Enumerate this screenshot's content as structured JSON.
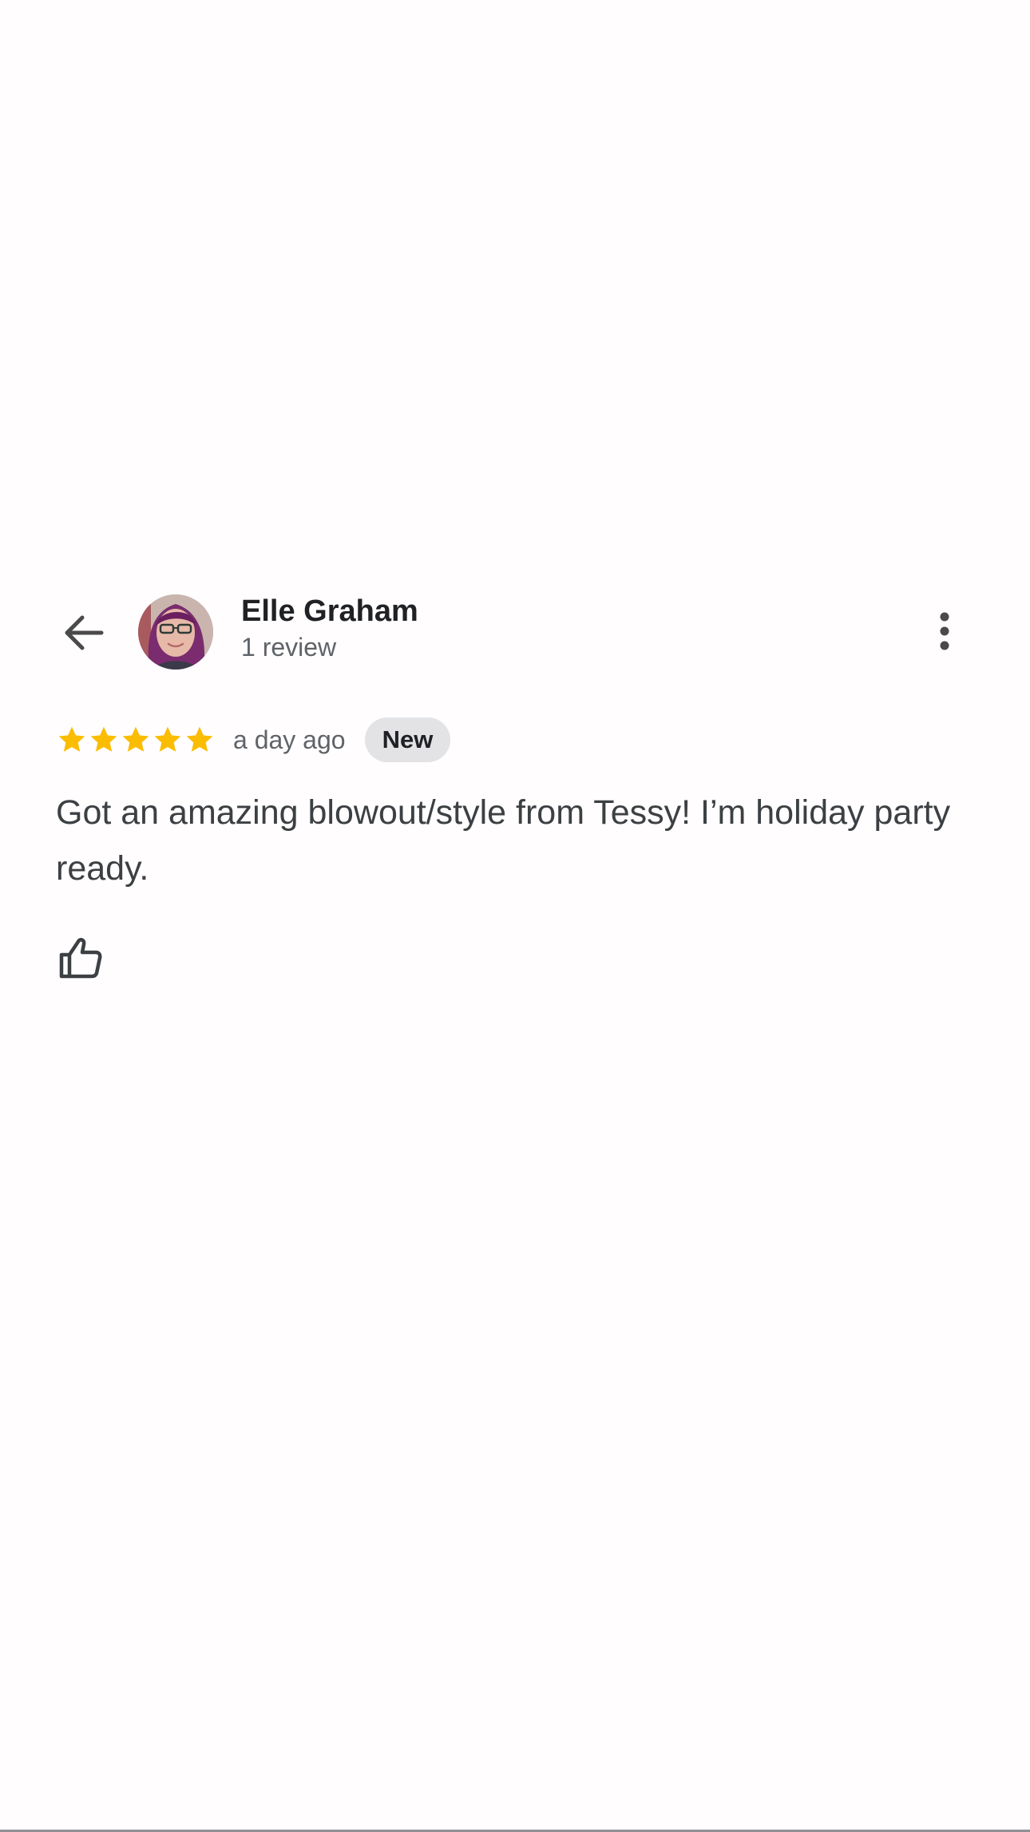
{
  "review": {
    "user": {
      "name": "Elle Graham",
      "review_count": "1 review"
    },
    "rating": {
      "stars": 5,
      "max_stars": 5,
      "star_color": "#fbbc04"
    },
    "timestamp": "a day ago",
    "badge": "New",
    "text": "Got an amazing blowout/style from Tessy! I’m holiday party ready."
  },
  "icons": {
    "back": "arrow-left-icon",
    "more": "more-vertical-icon",
    "like": "thumbs-up-icon",
    "star": "star-icon"
  },
  "colors": {
    "text_primary": "#202124",
    "text_secondary": "#5f6368",
    "badge_bg": "#e3e3e6",
    "icon": "#4a4a4a"
  }
}
